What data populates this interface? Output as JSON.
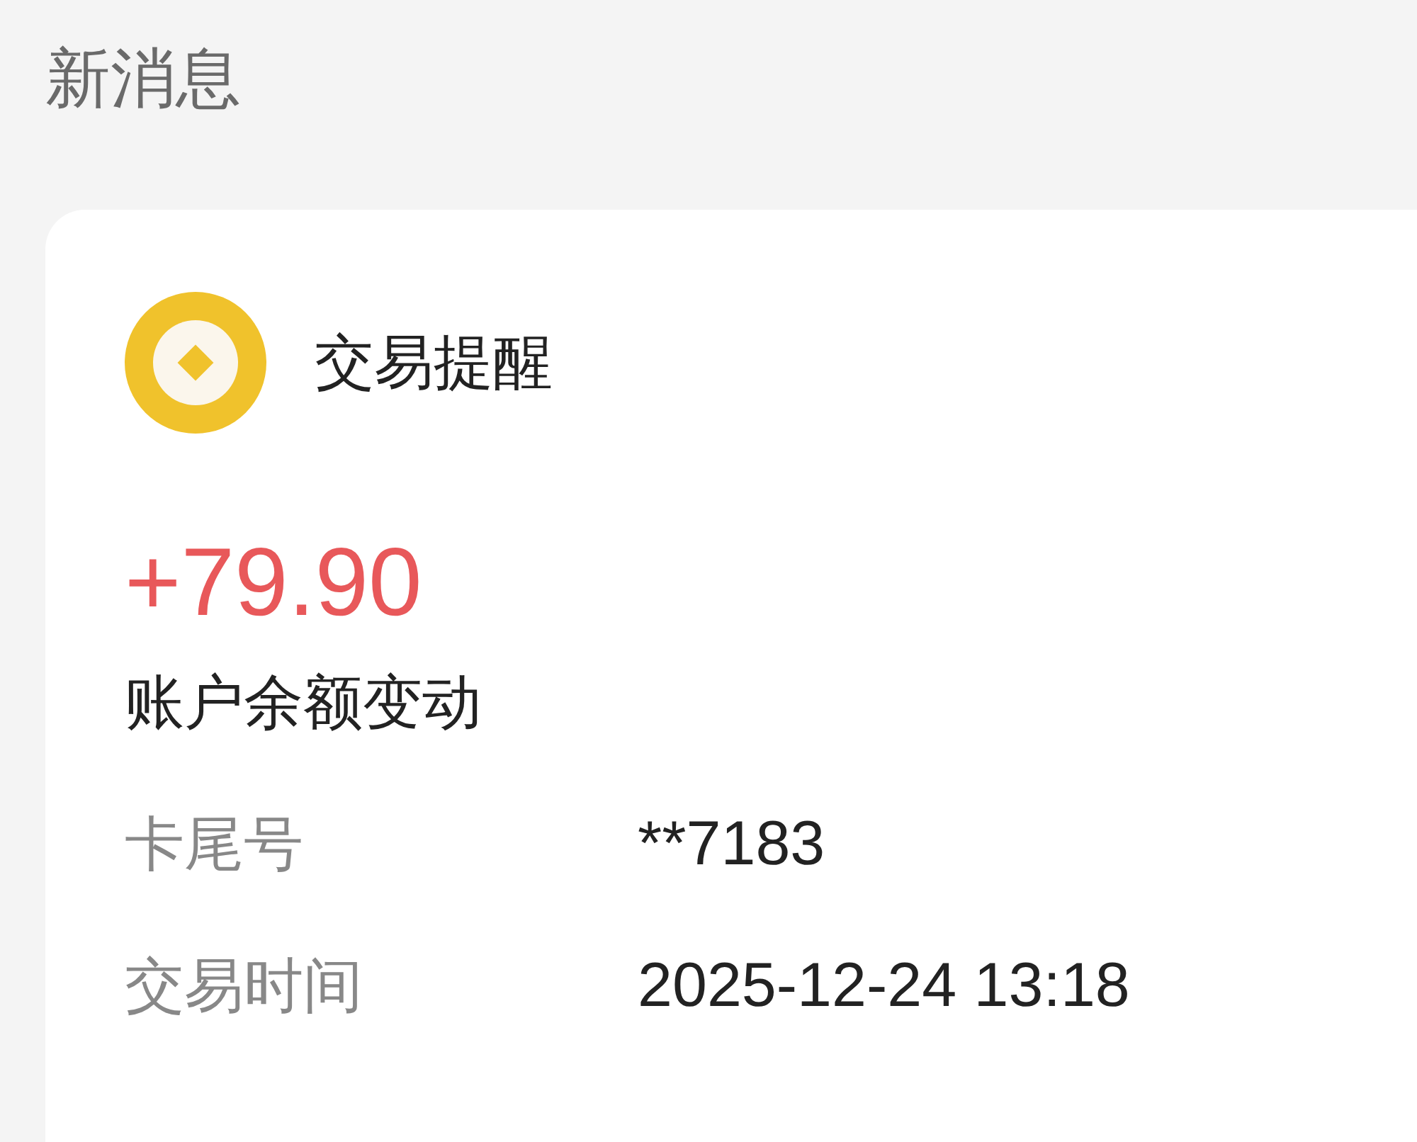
{
  "header": {
    "title": "新消息"
  },
  "card": {
    "title": "交易提醒",
    "amount": "+79.90",
    "description": "账户余额变动",
    "fields": [
      {
        "label": "卡尾号",
        "value": "**7183"
      },
      {
        "label": "交易时间",
        "value": "2025-12-24 13:18"
      }
    ]
  }
}
